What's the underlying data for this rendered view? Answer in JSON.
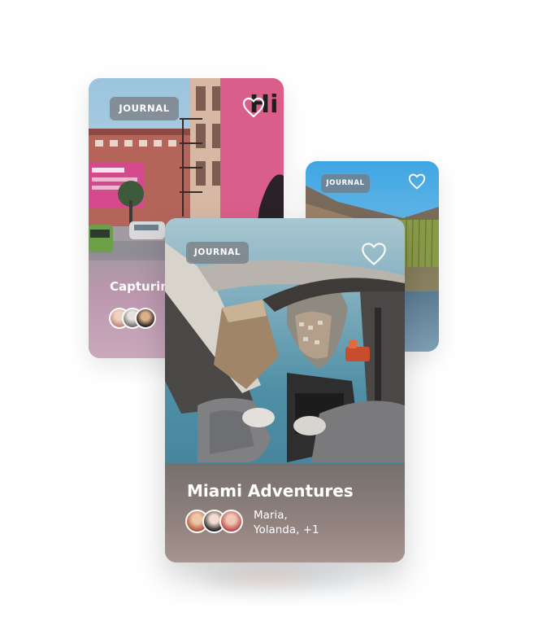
{
  "cards": {
    "city": {
      "badge": "JOURNAL",
      "title": "Capturing",
      "heart_icon": "heart-outline-icon",
      "sign_text": "Hi"
    },
    "lake": {
      "badge": "JOURNAL",
      "heart_icon": "heart-outline-icon"
    },
    "front": {
      "badge": "JOURNAL",
      "title": "Miami Adventures",
      "people_line1": "Maria,",
      "people_line2": "Yolanda, +1",
      "heart_icon": "heart-outline-icon"
    }
  },
  "colors": {
    "badge_bg": "#7a7a7e",
    "heart_stroke": "#ffffff",
    "pink_wall": "#e0638f",
    "sky": "#9ec6df",
    "ocean": "#4f8fa6"
  }
}
